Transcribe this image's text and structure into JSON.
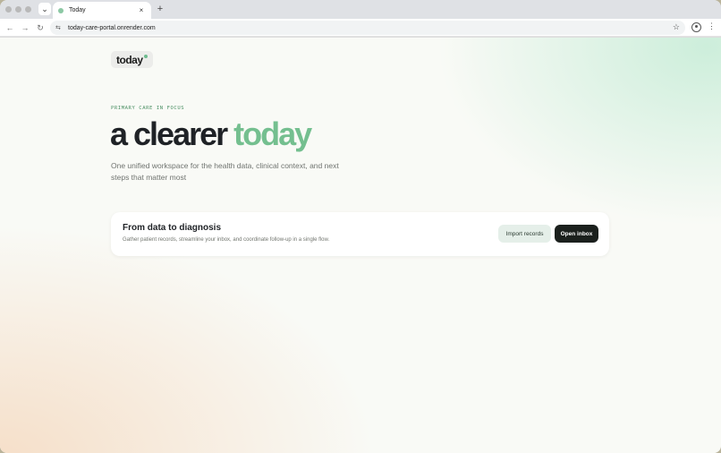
{
  "browser": {
    "tab": {
      "title": "Today",
      "close": "×"
    },
    "new_tab": "+",
    "tab_search": "⌄",
    "nav": {
      "back": "←",
      "forward": "→",
      "reload": "↻"
    },
    "site_info": "⇆",
    "url": "today-care-portal.onrender.com",
    "bookmark": "☆",
    "menu": "⋮"
  },
  "page": {
    "logo": "today",
    "eyebrow": "PRIMARY CARE IN FOCUS",
    "headline_main": "a clearer",
    "headline_accent": "today",
    "subhead": "One unified workspace for the health data, clinical context, and next steps that matter most",
    "card": {
      "title": "From data to diagnosis",
      "description": "Gather patient records, streamline your inbox, and coordinate follow-up in a single flow.",
      "secondary_button": "Import records",
      "primary_button": "Open inbox"
    }
  },
  "colors": {
    "accent": "#74bf8f",
    "eyebrow": "#4a8f63",
    "primary_button": "#1b201d",
    "secondary_button": "#e5efe9"
  }
}
